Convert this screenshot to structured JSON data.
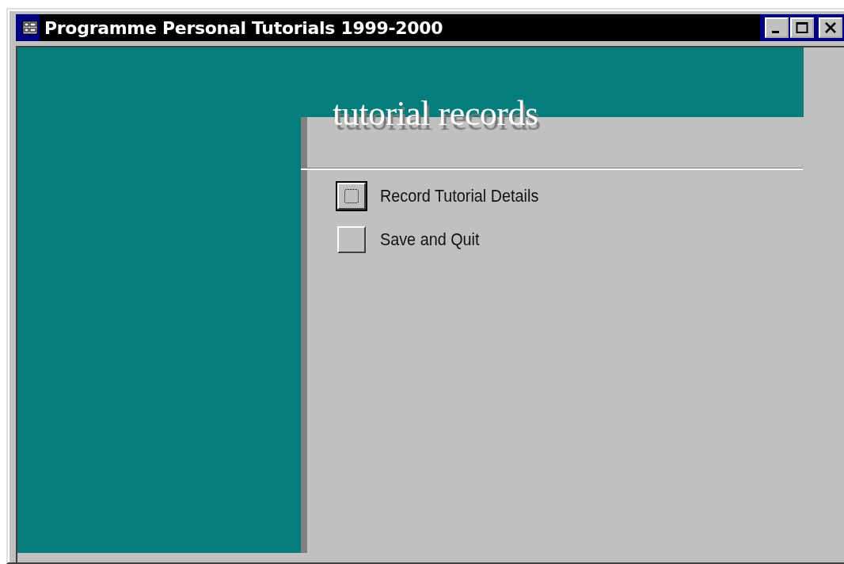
{
  "window": {
    "title": "Programme Personal Tutorials 1999-2000"
  },
  "heading": "tutorial records",
  "buttons": [
    {
      "label": "Record Tutorial Details",
      "focused": true
    },
    {
      "label": "Save and Quit",
      "focused": false
    }
  ]
}
